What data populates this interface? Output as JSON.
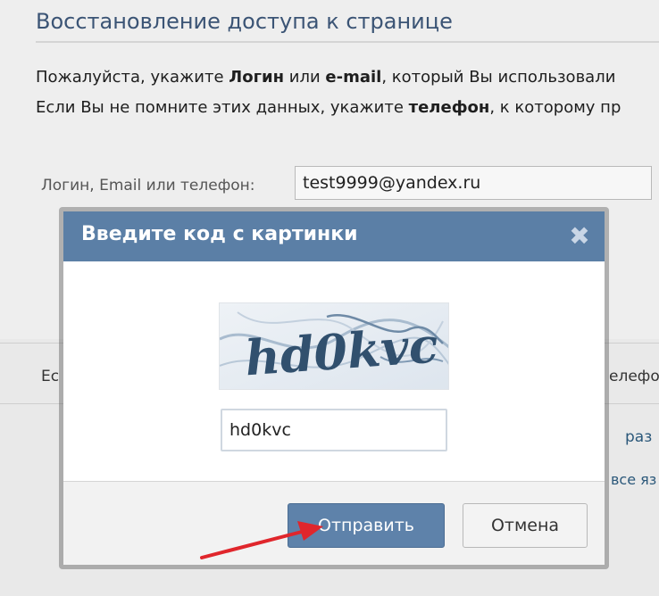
{
  "page": {
    "title": "Восстановление доступа к странице",
    "instruction_line1": {
      "pre": "Пожалуйста, укажите ",
      "bold1": "Логин",
      "mid": " или ",
      "bold2": "e-mail",
      "post": ", который Вы использовали"
    },
    "instruction_line2": {
      "pre": "Если Вы не помните этих данных, укажите ",
      "bold": "телефон",
      "post": ", к которому пр"
    },
    "login_label": "Логин, Email или телефон:",
    "login_value": "test9999@yandex.ru",
    "behind_left": "Ес",
    "behind_right": "елефон",
    "behind_link1": "раз",
    "behind_link2": "все яз"
  },
  "modal": {
    "title": "Введите код с картинки",
    "close_icon": "close-icon",
    "captcha_text": "hd0kvc",
    "captcha_input_value": "hd0kvc",
    "send_label": "Отправить",
    "cancel_label": "Отмена"
  },
  "colors": {
    "header": "#5b7fa6",
    "primary_button": "#5e82aa",
    "arrow": "#e0262c",
    "page_title": "#3b5475"
  }
}
